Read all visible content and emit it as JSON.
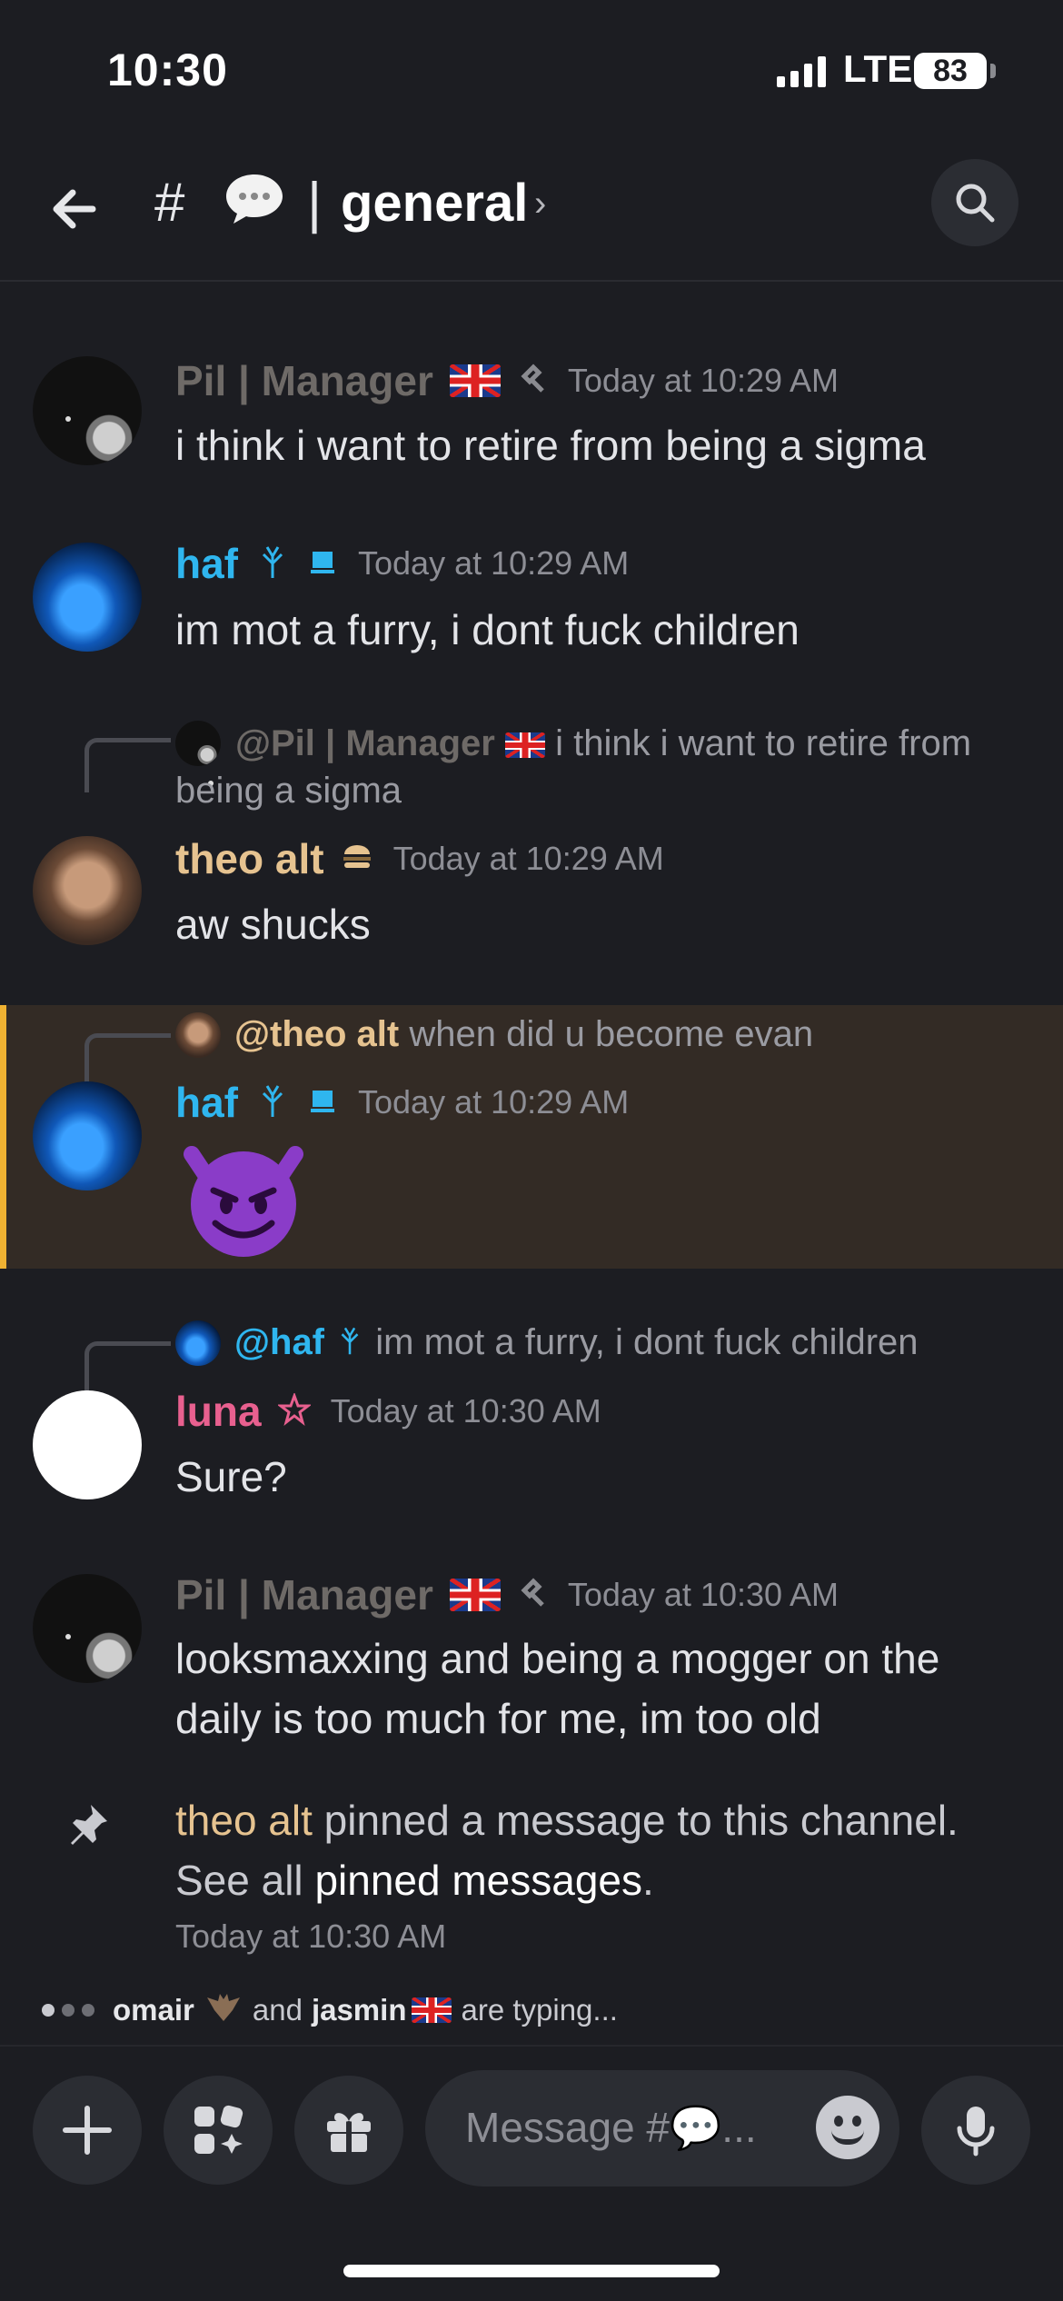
{
  "status_bar": {
    "time": "10:30",
    "carrier": "LTE",
    "battery": "83"
  },
  "header": {
    "hash": "#",
    "separator": "|",
    "channel_name": "general",
    "chevron": "›"
  },
  "messages": [
    {
      "author": "Pil | Manager",
      "time": "Today at 10:29 AM",
      "text": "i think i want to retire from being a sigma"
    },
    {
      "author": "haf",
      "time": "Today at 10:29 AM",
      "text": "im mot a furry, i dont fuck children"
    },
    {
      "reply_author": "@Pil | Manager",
      "reply_text": "i think i want to retire from being a sigma",
      "author": "theo alt",
      "time": "Today at 10:29 AM",
      "text": "aw shucks"
    },
    {
      "reply_author": "@theo alt",
      "reply_text": "when did u become evan",
      "author": "haf",
      "time": "Today at 10:29 AM"
    },
    {
      "reply_author": "@haf",
      "reply_text": "im mot a furry, i dont fuck children",
      "author": "luna",
      "time": "Today at 10:30 AM",
      "text": "Sure?"
    },
    {
      "author": "Pil | Manager",
      "time": "Today at 10:30 AM",
      "text": "looksmaxxing and being a mogger on the daily is too much for me, im too old"
    }
  ],
  "system": {
    "actor": "theo alt",
    "text_1": " pinned a message to this channel. See all ",
    "link": "pinned messages",
    "text_2": ".",
    "time": "Today at 10:30 AM"
  },
  "typing": {
    "user1": "omair",
    "and": "and",
    "user2": "jasmin",
    "suffix": "are typing..."
  },
  "composer": {
    "placeholder": "Message #💬..."
  },
  "colors": {
    "background": "#1c1d22",
    "mention_highlight": "#332b25",
    "highlight_bar": "#f0b232",
    "haf": "#2fb6ef",
    "theo": "#e6c390",
    "luna": "#e8608f"
  }
}
